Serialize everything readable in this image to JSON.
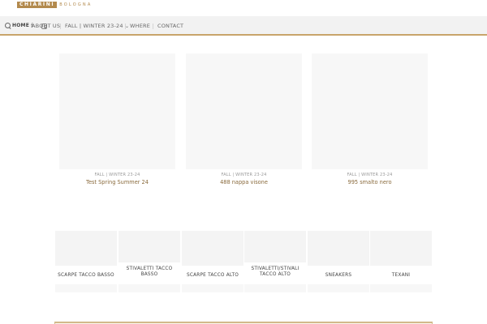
{
  "logo": {
    "brand": "CHIARINI",
    "sub": "BOLOGNA"
  },
  "nav": {
    "overlap_home": "HOME",
    "about": "ABOUT US",
    "collection": "FALL | WINTER 23-24",
    "where": "WHERE",
    "contact": "CONTACT",
    "dropdown_glyph": "⌄"
  },
  "icons": {
    "search": "search-icon",
    "facebook": "f",
    "instagram": "instagram-icon"
  },
  "products": [
    {
      "category": "FALL | WINTER 23-24",
      "title": "Test Spring Summer 24"
    },
    {
      "category": "FALL | WINTER 23-24",
      "title": "488 nappa visone"
    },
    {
      "category": "FALL | WINTER 23-24",
      "title": "995 smalto nero"
    }
  ],
  "categories": [
    {
      "label": "SCARPE TACCO BASSO"
    },
    {
      "label": "STIVALETTI TACCO BASSO"
    },
    {
      "label": "SCARPE TACCO ALTO"
    },
    {
      "label": "STIVALETTI/STIVALI TACCO ALTO"
    },
    {
      "label": "SNEAKERS"
    },
    {
      "label": "TEXANI"
    }
  ],
  "colors": {
    "accent": "#c8a46a",
    "brand": "#b38a4d",
    "title": "#8a6b3d"
  }
}
